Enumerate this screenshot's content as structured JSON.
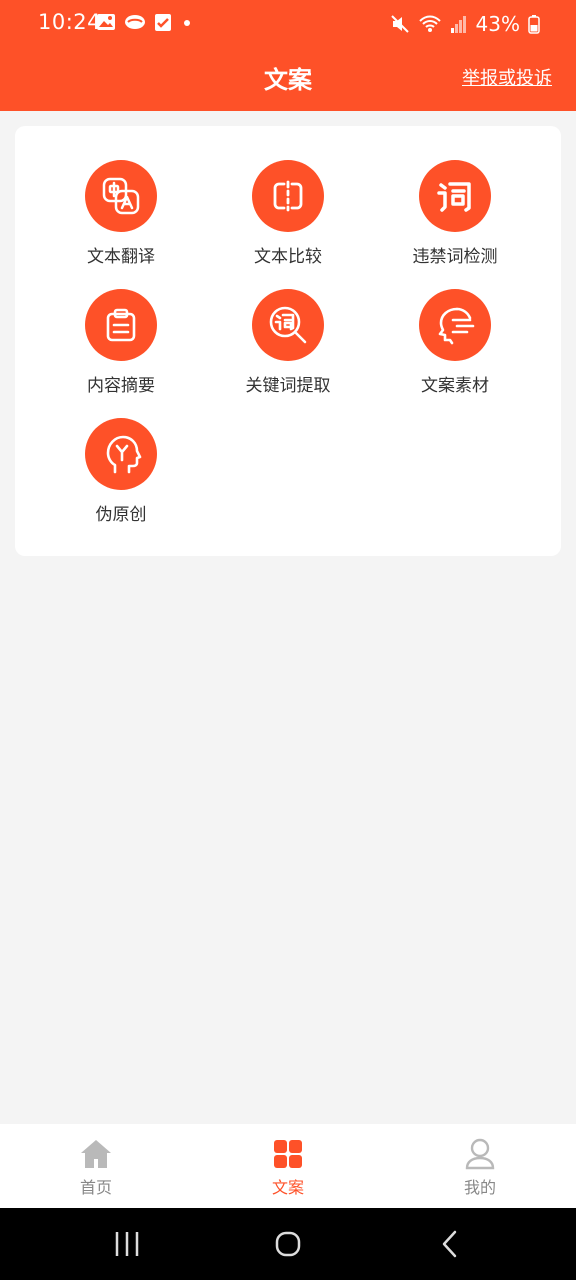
{
  "status_bar": {
    "time": "10:24",
    "battery_percent": "43%",
    "left_icons": [
      "image-icon",
      "cloud-icon",
      "check-box-icon",
      "dot-icon"
    ],
    "right_icons": [
      "mute-icon",
      "wifi-icon",
      "signal-icon",
      "battery-icon"
    ]
  },
  "header": {
    "title": "文案",
    "report_link": "举报或投诉"
  },
  "tools": [
    {
      "label": "文本翻译",
      "icon": "translate-icon"
    },
    {
      "label": "文本比较",
      "icon": "compare-icon"
    },
    {
      "label": "违禁词检测",
      "icon": "forbidden-word-icon"
    },
    {
      "label": "内容摘要",
      "icon": "clipboard-icon"
    },
    {
      "label": "关键词提取",
      "icon": "keyword-search-icon"
    },
    {
      "label": "文案素材",
      "icon": "material-face-icon"
    },
    {
      "label": "伪原创",
      "icon": "brain-head-icon"
    }
  ],
  "tabbar": {
    "items": [
      {
        "label": "首页",
        "icon": "home-icon",
        "active": false
      },
      {
        "label": "文案",
        "icon": "grid-icon",
        "active": true
      },
      {
        "label": "我的",
        "icon": "user-icon",
        "active": false
      }
    ]
  },
  "colors": {
    "accent": "#fe5128",
    "background": "#f4f4f4",
    "inactive_tab": "#888888"
  },
  "system_nav": [
    "recent-apps-icon",
    "home-circle-icon",
    "back-icon"
  ]
}
